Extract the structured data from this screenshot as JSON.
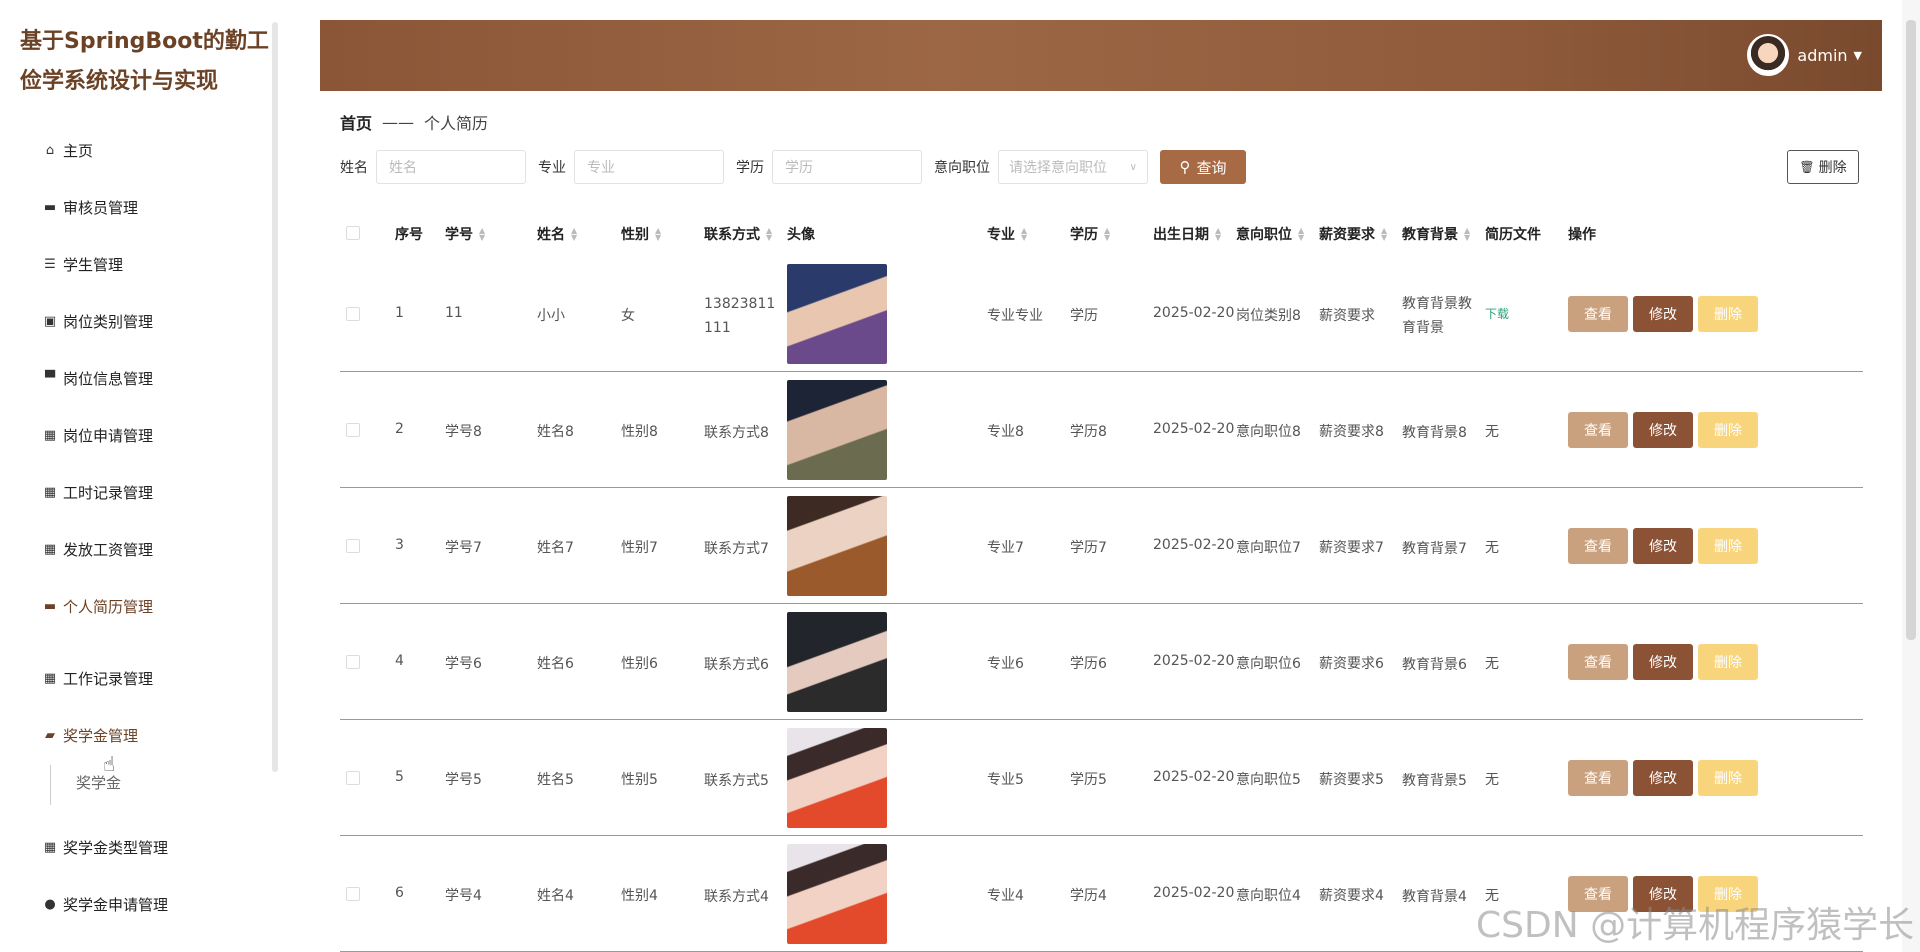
{
  "app": {
    "title": "基于SpringBoot的勤工俭学系统设计与实现"
  },
  "sidebar": {
    "items": [
      {
        "label": "主页",
        "icon": "home-icon"
      },
      {
        "label": "审核员管理",
        "icon": "reviewer-icon"
      },
      {
        "label": "学生管理",
        "icon": "list-icon"
      },
      {
        "label": "岗位类别管理",
        "icon": "clipboard-icon"
      },
      {
        "label": "岗位信息管理",
        "icon": "monitor-icon"
      },
      {
        "label": "岗位申请管理",
        "icon": "grid-icon"
      },
      {
        "label": "工时记录管理",
        "icon": "grid-icon"
      },
      {
        "label": "发放工资管理",
        "icon": "grid-icon"
      },
      {
        "label": "个人简历管理",
        "icon": "chat-icon"
      },
      {
        "label": "工作记录管理",
        "icon": "apps-icon"
      },
      {
        "label": "奖学金管理",
        "icon": "wallet-icon"
      },
      {
        "label": "奖学金类型管理",
        "icon": "grid-icon"
      },
      {
        "label": "奖学金申请管理",
        "icon": "bulb-icon"
      }
    ],
    "submenu_item": "奖学金"
  },
  "header": {
    "username": "admin"
  },
  "breadcrumb": {
    "home": "首页",
    "separator": "——",
    "current": "个人简历"
  },
  "filters": {
    "name_label": "姓名",
    "name_placeholder": "姓名",
    "major_label": "专业",
    "major_placeholder": "专业",
    "edu_label": "学历",
    "edu_placeholder": "学历",
    "job_label": "意向职位",
    "job_placeholder": "请选择意向职位",
    "search_label": "查询",
    "delete_label": "删除"
  },
  "table": {
    "headers": {
      "index": "序号",
      "student_no": "学号",
      "name": "姓名",
      "gender": "性别",
      "contact": "联系方式",
      "avatar": "头像",
      "major": "专业",
      "education": "学历",
      "birth": "出生日期",
      "job": "意向职位",
      "salary": "薪资要求",
      "background": "教育背景",
      "resume": "简历文件",
      "actions": "操作"
    },
    "rows": [
      {
        "index": "1",
        "student_no": "11",
        "name": "小小",
        "gender": "女",
        "contact": "13823811111",
        "major": "专业专业",
        "education": "学历",
        "birth": "2025-02-20",
        "job": "岗位类别8",
        "salary": "薪资要求",
        "background": "教育背景教育背景",
        "resume": "下载"
      },
      {
        "index": "2",
        "student_no": "学号8",
        "name": "姓名8",
        "gender": "性别8",
        "contact": "联系方式8",
        "major": "专业8",
        "education": "学历8",
        "birth": "2025-02-20",
        "job": "意向职位8",
        "salary": "薪资要求8",
        "background": "教育背景8",
        "resume": "无"
      },
      {
        "index": "3",
        "student_no": "学号7",
        "name": "姓名7",
        "gender": "性别7",
        "contact": "联系方式7",
        "major": "专业7",
        "education": "学历7",
        "birth": "2025-02-20",
        "job": "意向职位7",
        "salary": "薪资要求7",
        "background": "教育背景7",
        "resume": "无"
      },
      {
        "index": "4",
        "student_no": "学号6",
        "name": "姓名6",
        "gender": "性别6",
        "contact": "联系方式6",
        "major": "专业6",
        "education": "学历6",
        "birth": "2025-02-20",
        "job": "意向职位6",
        "salary": "薪资要求6",
        "background": "教育背景6",
        "resume": "无"
      },
      {
        "index": "5",
        "student_no": "学号5",
        "name": "姓名5",
        "gender": "性别5",
        "contact": "联系方式5",
        "major": "专业5",
        "education": "学历5",
        "birth": "2025-02-20",
        "job": "意向职位5",
        "salary": "薪资要求5",
        "background": "教育背景5",
        "resume": "无"
      },
      {
        "index": "6",
        "student_no": "学号4",
        "name": "姓名4",
        "gender": "性别4",
        "contact": "联系方式4",
        "major": "专业4",
        "education": "学历4",
        "birth": "2025-02-20",
        "job": "意向职位4",
        "salary": "薪资要求4",
        "background": "教育背景4",
        "resume": "无"
      }
    ],
    "action_labels": {
      "view": "查看",
      "edit": "修改",
      "delete": "删除"
    }
  },
  "colors": {
    "accent": "#a86a45",
    "header": "#8a5637",
    "view": "#c9a17f",
    "edit": "#8b5235",
    "delete": "#f8d57c"
  },
  "watermark": "CSDN @计算机程序猿学长"
}
